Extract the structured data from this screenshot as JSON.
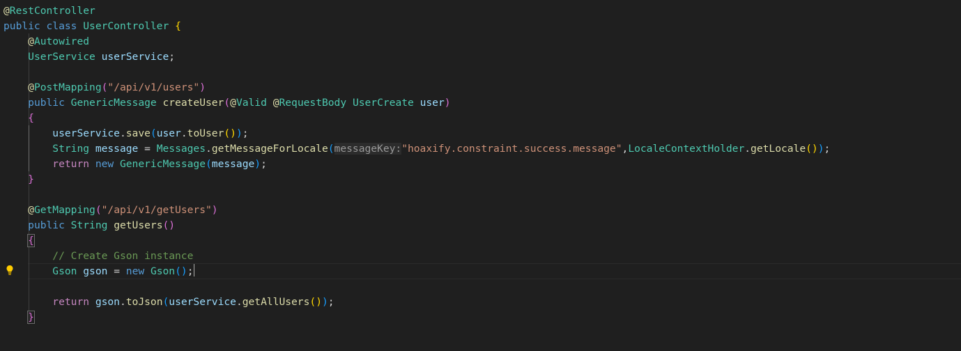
{
  "editor": {
    "language": "java",
    "theme": "dark",
    "lines": [
      "@RestController",
      "public class UserController {",
      "    @Autowired",
      "    UserService userService;",
      "",
      "    @PostMapping(\"/api/v1/users\")",
      "    public GenericMessage createUser(@Valid @RequestBody UserCreate user)",
      "    {",
      "        userService.save(user.toUser());",
      "        String message = Messages.getMessageForLocale(messageKey:\"hoaxify.constraint.success.message\",LocaleContextHolder.getLocale());",
      "        return new GenericMessage(message);",
      "    }",
      "",
      "    @GetMapping(\"/api/v1/getUsers\")",
      "    public String getUsers()",
      "    {",
      "        // Create Gson instance",
      "        Gson gson = new Gson();",
      "",
      "        return gson.toJson(userService.getAllUsers());",
      "    }"
    ],
    "inlay_hint": "messageKey:",
    "active_line": 18,
    "gutter_icon": "lightbulb-icon",
    "colors": {
      "background": "#1f1f1f",
      "keyword": "#569cd6",
      "type": "#4ec9b0",
      "function": "#dcdcaa",
      "string": "#ce9178",
      "variable": "#9cdcfe",
      "comment": "#6a9955",
      "bracket_level_1": "#ffd700",
      "bracket_level_2": "#da70d6",
      "bracket_level_3": "#179fff",
      "lightbulb": "#ffcc00"
    },
    "tokens": {
      "at": "@",
      "rest_controller": "RestController",
      "public": "public",
      "class": "class",
      "user_controller": "UserController",
      "lbrace": "{",
      "rbrace": "}",
      "autowired": "Autowired",
      "user_service_type": "UserService",
      "user_service_var": "userService",
      "semicolon": ";",
      "post_mapping": "PostMapping",
      "lparen": "(",
      "rparen": ")",
      "users_path": "\"/api/v1/users\"",
      "generic_message": "GenericMessage",
      "create_user": "createUser",
      "valid": "Valid",
      "request_body": "RequestBody",
      "user_create": "UserCreate",
      "user": "user",
      "dot": ".",
      "save": "save",
      "to_user": "toUser",
      "string_type": "String",
      "message": "message",
      "equals": "=",
      "messages": "Messages",
      "get_message_for_locale": "getMessageForLocale",
      "message_key_string": "\"hoaxify.constraint.success.message\"",
      "comma": ",",
      "locale_context_holder": "LocaleContextHolder",
      "get_locale": "getLocale",
      "return": "return",
      "new": "new",
      "get_mapping": "GetMapping",
      "get_users_path": "\"/api/v1/getUsers\"",
      "get_users": "getUsers",
      "comment": "// Create Gson instance",
      "gson_type": "Gson",
      "gson_var": "gson",
      "to_json": "toJson",
      "get_all_users": "getAllUsers"
    }
  }
}
